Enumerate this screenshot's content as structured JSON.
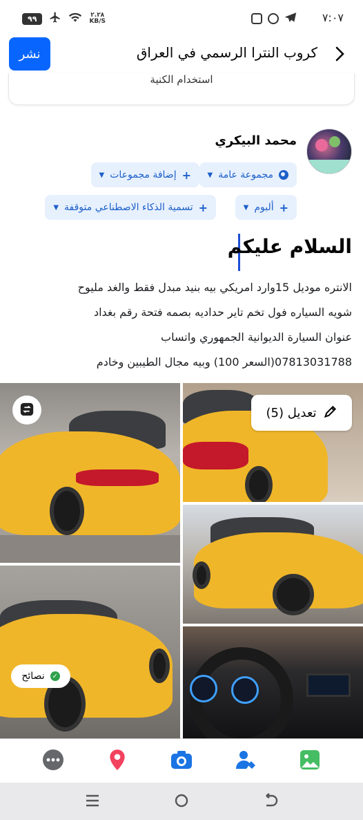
{
  "status_bar": {
    "time": "٧:٠٧",
    "battery": "٩٩",
    "network_speed_value": "٢.٢٨",
    "network_speed_unit": "KB/S"
  },
  "header": {
    "title": "كروب النترا الرسمي في العراق",
    "publish_label": "نشر"
  },
  "card_fragment": {
    "label": "استخدام الكنية"
  },
  "post": {
    "author": "محمد البيكري",
    "audience_chip": "مجموعة عامة",
    "add_groups_chip": "إضافة مجموعات",
    "album_chip": "ألبوم",
    "ai_label_chip": "تسمية الذكاء الاصطناعي متوقفة",
    "heading": "السلام عليكم",
    "body_lines": [
      "الانتره موديل 15وارد امريكي بيه بنيد مبدل فقط والغد مليوح",
      "شويه السياره فول تخم تاير حداديه  بصمه فتحة رقم بغداد",
      "عنوان السيارة الديوانية الجمهوري واتساب",
      "07813031788(السعر 100) وبيه مجال الطيبين وخادم"
    ]
  },
  "photos": {
    "edit_label": "تعديل (5)",
    "tips_label": "نصائح"
  },
  "colors": {
    "accent": "#0866ff",
    "chip_bg": "#e7f0fd",
    "chip_text": "#1b5fc9"
  }
}
